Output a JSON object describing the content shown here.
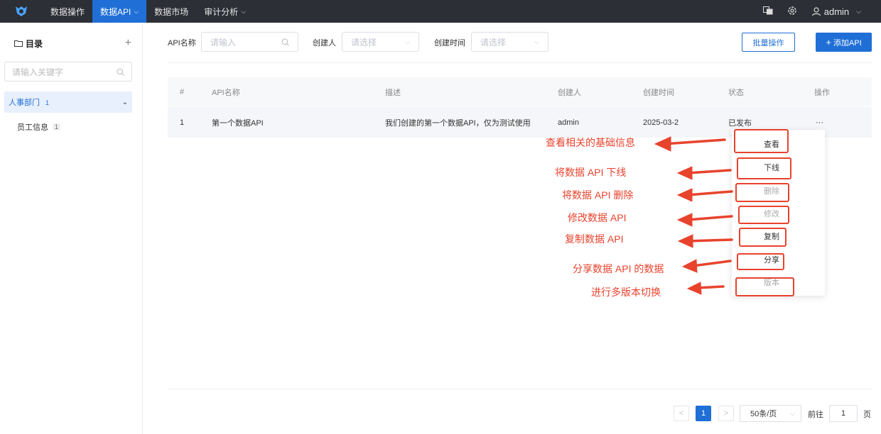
{
  "topbar": {
    "nav": [
      {
        "label": "数据操作",
        "active": false,
        "has_dropdown": false
      },
      {
        "label": "数据API",
        "active": true,
        "has_dropdown": true
      },
      {
        "label": "数据市场",
        "active": false,
        "has_dropdown": false
      },
      {
        "label": "审计分析",
        "active": false,
        "has_dropdown": true
      }
    ],
    "username": "admin"
  },
  "sidebar": {
    "title": "目录",
    "search_placeholder": "请输入关键字",
    "department": {
      "label": "人事部门",
      "count": "1"
    },
    "items": [
      {
        "label": "员工信息",
        "count": "1"
      }
    ]
  },
  "filters": {
    "api_name_label": "API名称",
    "api_name_placeholder": "请输入",
    "creator_label": "创建人",
    "creator_placeholder": "请选择",
    "created_time_label": "创建时间",
    "created_time_placeholder": "请选择"
  },
  "actions": {
    "batch": "批量操作",
    "add": "添加API"
  },
  "table": {
    "headers": [
      "#",
      "API名称",
      "描述",
      "创建人",
      "创建时间",
      "状态",
      "操作"
    ],
    "rows": [
      {
        "index": "1",
        "name": "第一个数据API",
        "description": "我们创建的第一个数据API，仅为测试使用",
        "creator": "admin",
        "created": "2025-03-2",
        "status": "已发布",
        "op": "···"
      }
    ]
  },
  "row_menu": [
    {
      "label": "查看",
      "enabled": true
    },
    {
      "label": "下线",
      "enabled": true
    },
    {
      "label": "删除",
      "enabled": false
    },
    {
      "label": "修改",
      "enabled": false
    },
    {
      "label": "复制",
      "enabled": true
    },
    {
      "label": "分享",
      "enabled": true
    },
    {
      "label": "版本",
      "enabled": false
    }
  ],
  "annotations": [
    "查看相关的基础信息",
    "将数据 API 下线",
    "将数据 API 删除",
    "修改数据 API",
    "复制数据 API",
    "分享数据 API 的数据",
    "进行多版本切换"
  ],
  "pagination": {
    "prev": "<",
    "current": "1",
    "next": ">",
    "page_size": "50条/页",
    "goto_label": "前往",
    "goto_value": "1",
    "page_suffix": "页"
  },
  "colors": {
    "primary": "#1f6fd6",
    "annotation": "#e8432d",
    "topbar": "#2c2f36"
  }
}
